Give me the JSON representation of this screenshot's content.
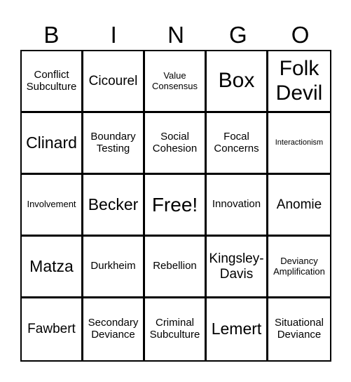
{
  "header": {
    "letters": [
      "B",
      "I",
      "N",
      "G",
      "O"
    ]
  },
  "board": {
    "cells": [
      {
        "text": "Conflict Subculture",
        "size": "md"
      },
      {
        "text": "Cicourel",
        "size": "lg"
      },
      {
        "text": "Value Consensus",
        "size": "sm"
      },
      {
        "text": "Box",
        "size": "xxl"
      },
      {
        "text": "Folk Devil",
        "size": "xxl"
      },
      {
        "text": "Clinard",
        "size": "xl"
      },
      {
        "text": "Boundary Testing",
        "size": "md"
      },
      {
        "text": "Social Cohesion",
        "size": "md"
      },
      {
        "text": "Focal Concerns",
        "size": "md"
      },
      {
        "text": "Interactionism",
        "size": "xs"
      },
      {
        "text": "Involvement",
        "size": "sm"
      },
      {
        "text": "Becker",
        "size": "xl"
      },
      {
        "text": "Free!",
        "size": "free"
      },
      {
        "text": "Innovation",
        "size": "md"
      },
      {
        "text": "Anomie",
        "size": "lg"
      },
      {
        "text": "Matza",
        "size": "xl"
      },
      {
        "text": "Durkheim",
        "size": "md"
      },
      {
        "text": "Rebellion",
        "size": "md"
      },
      {
        "text": "Kingsley-Davis",
        "size": "lg"
      },
      {
        "text": "Deviancy Amplification",
        "size": "sm"
      },
      {
        "text": "Fawbert",
        "size": "lg"
      },
      {
        "text": "Secondary Deviance",
        "size": "md"
      },
      {
        "text": "Criminal Subculture",
        "size": "md"
      },
      {
        "text": "Lemert",
        "size": "xl"
      },
      {
        "text": "Situational Deviance",
        "size": "md"
      }
    ]
  }
}
